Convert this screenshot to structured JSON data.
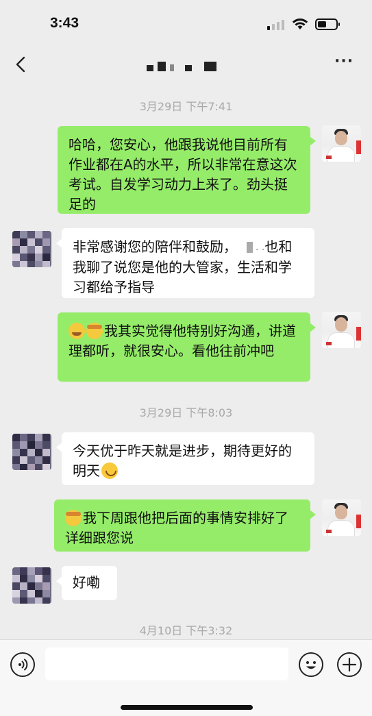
{
  "status_bar": {
    "time": "3:43"
  },
  "nav": {
    "title": "▄▌▖ ▗ ▛"
  },
  "messages": [
    {
      "type": "timestamp",
      "text": "3月29日 下午7:41"
    },
    {
      "type": "out",
      "text": "哈哈，您安心，他跟我说他目前所有作业都在A的水平，所以非常在意这次考试。自发学习动力上来了。劲头挺足的"
    },
    {
      "type": "in",
      "text_before": "非常感谢您的陪伴和鼓励，",
      "text_after": "也和我聊了说您是他的大管家，生活和学习都给予指导",
      "redact_tail": ". ."
    },
    {
      "type": "out",
      "emoji": [
        "crying-face",
        "shushing-face"
      ],
      "text": "我其实觉得他特别好沟通，讲道理都听，就很安心。看他往前冲吧"
    },
    {
      "type": "timestamp",
      "text": "3月29日 下午8:03"
    },
    {
      "type": "in",
      "text": "今天优于昨天就是进步，期待更好的明天"
    },
    {
      "type": "out",
      "emoji": [
        "shushing-face"
      ],
      "text": "我下周跟他把后面的事情安排好了详细跟您说"
    },
    {
      "type": "in",
      "text": "好嘞"
    },
    {
      "type": "timestamp",
      "text": "4月10日 下午3:32"
    }
  ],
  "input": {
    "value": ""
  },
  "colors": {
    "outgoing_bubble": "#95ec69",
    "incoming_bubble": "#ffffff",
    "background": "#ededed",
    "timestamp": "#a8a8a8"
  },
  "icons": [
    "back-arrow",
    "more-dots",
    "voice",
    "emoji",
    "plus",
    "wifi",
    "battery",
    "cellular-signal"
  ]
}
